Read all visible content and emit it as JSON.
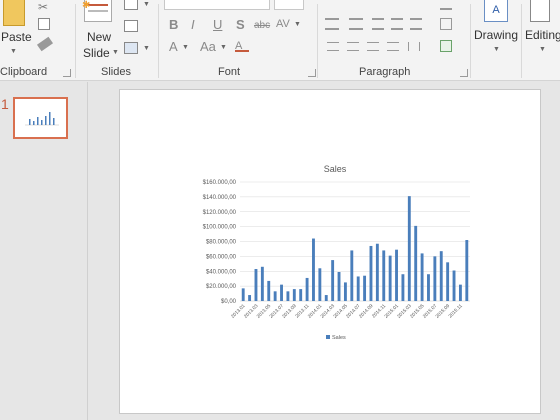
{
  "ribbon": {
    "groups": {
      "clipboard": "Clipboard",
      "slides": "Slides",
      "font": "Font",
      "paragraph": "Paragraph"
    },
    "paste_label": "Paste",
    "new_slide_label_1": "New",
    "new_slide_label_2": "Slide",
    "drawing_label": "Drawing",
    "editing_label": "Editing",
    "font_buttons": {
      "bold": "B",
      "italic": "I",
      "underline": "U",
      "strike": "S",
      "abc": "abc",
      "spacing": "AV",
      "font_color": "A",
      "change_case": "Aa"
    }
  },
  "thumbnail": {
    "slide_number": "1"
  },
  "colors": {
    "accent": "#d9704f",
    "bar": "#4a7ebb",
    "grid": "#d9d9d9"
  },
  "chart_data": {
    "type": "bar",
    "title": "Sales",
    "legend": [
      "Sales"
    ],
    "legend_position": "bottom",
    "ylim": [
      0,
      160000
    ],
    "yticks": [
      "$0,00",
      "$20.000,00",
      "$40.000,00",
      "$60.000,00",
      "$80.000,00",
      "$100.000,00",
      "$120.000,00",
      "$140.000,00",
      "$160.000,00"
    ],
    "xtick_labels": [
      "2013.01",
      "2013.03",
      "2013.05",
      "2013.07",
      "2013.09",
      "2013.11",
      "2014.01",
      "2014.03",
      "2014.05",
      "2014.07",
      "2014.09",
      "2014.11",
      "2015.01",
      "2015.03",
      "2015.05",
      "2015.07",
      "2015.09",
      "2015.11"
    ],
    "series": [
      {
        "name": "Sales",
        "values": [
          17000,
          8000,
          43000,
          46000,
          27000,
          13000,
          22000,
          13000,
          16000,
          16000,
          31000,
          84000,
          44000,
          8000,
          55000,
          39000,
          25000,
          68000,
          33000,
          34000,
          74000,
          77000,
          68000,
          61000,
          69000,
          36000,
          141000,
          101000,
          64000,
          36000,
          60000,
          67000,
          52000,
          41000,
          22000,
          82000
        ]
      }
    ]
  }
}
